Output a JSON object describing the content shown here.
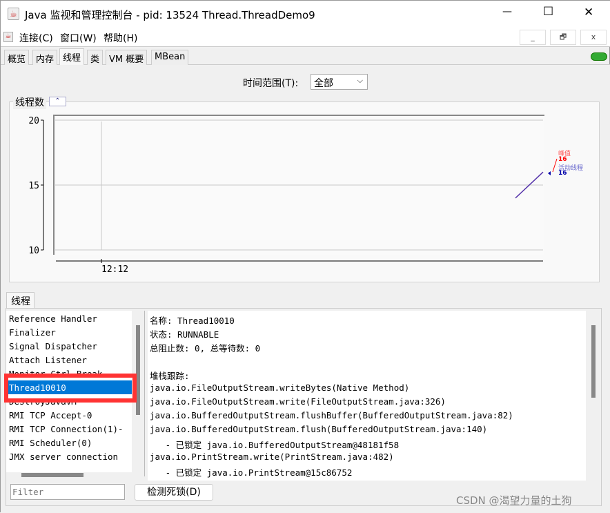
{
  "window": {
    "title": "Java 监视和管理控制台 - pid: 13524 Thread.ThreadDemo9",
    "min": "—",
    "max": "☐",
    "close": "✕"
  },
  "menu": {
    "items": [
      "连接(C)",
      "窗口(W)",
      "帮助(H)"
    ],
    "mdi": [
      "_",
      "🗗",
      "x"
    ]
  },
  "tabs": [
    "概览",
    "内存",
    "线程",
    "类",
    "VM 概要",
    "MBean"
  ],
  "time_range": {
    "label": "时间范围(T):",
    "value": "全部"
  },
  "chart": {
    "title": "线程数",
    "peak_label": "峰值",
    "peak_value": "16",
    "live_label": "活动线程",
    "live_value": "16",
    "peak_color": "#ff0000",
    "live_color": "#0000aa"
  },
  "chart_data": {
    "type": "line",
    "yticks": [
      "20",
      "15",
      "10"
    ],
    "ylim": [
      10,
      20
    ],
    "xticks": [
      "12:12"
    ],
    "series": [
      {
        "name": "活动线程",
        "values": [
          14,
          16
        ]
      }
    ],
    "grid": true
  },
  "threads": {
    "tab": "线程",
    "items": [
      "Reference Handler",
      "Finalizer",
      "Signal Dispatcher",
      "Attach Listener",
      "Monitor Ctrl-Break",
      "Thread10010",
      "DestroyJavaVM",
      "RMI TCP Accept-0",
      "RMI TCP Connection(1)-",
      "RMI Scheduler(0)",
      "JMX server connection"
    ],
    "selected": "Thread10010",
    "filter_placeholder": "Filter",
    "deadlock_button": "检测死锁(D)"
  },
  "details": {
    "name": "名称: Thread10010",
    "state": "状态: RUNNABLE",
    "counts": "总阻止数: 0, 总等待数: 0",
    "stack_label": "堆栈跟踪:",
    "stack": [
      "java.io.FileOutputStream.writeBytes(Native Method)",
      "java.io.FileOutputStream.write(FileOutputStream.java:326)",
      "java.io.BufferedOutputStream.flushBuffer(BufferedOutputStream.java:82)",
      "java.io.BufferedOutputStream.flush(BufferedOutputStream.java:140)",
      "   - 已锁定 java.io.BufferedOutputStream@48181f58",
      "java.io.PrintStream.write(PrintStream.java:482)",
      "   - 已锁定 java.io.PrintStream@15c86752"
    ]
  },
  "watermark": "CSDN @渴望力量的土狗"
}
